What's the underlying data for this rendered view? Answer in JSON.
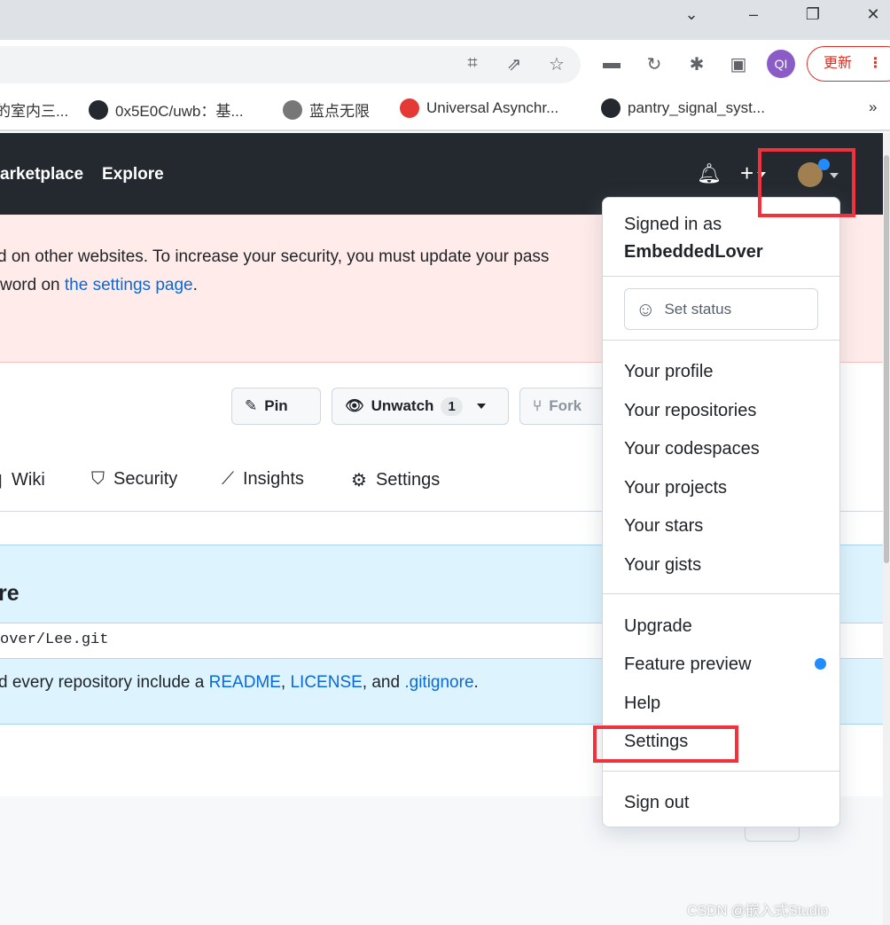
{
  "browser": {
    "bookmarks": [
      "的室内三...",
      "0x5E0C/uwb：基...",
      "蓝点无限",
      "Universal Asynchr...",
      "pantry_signal_syst..."
    ],
    "more": "»",
    "profile": "QI",
    "update_label": "更新"
  },
  "header": {
    "nav": [
      "arketplace",
      "Explore"
    ]
  },
  "banner": {
    "line1": "d on other websites. To increase your security, you must update your pass",
    "line2_pre": "word on ",
    "line2_link": "the settings page",
    "line2_post": "."
  },
  "repo_actions": {
    "pin": "Pin",
    "unwatch": "Unwatch",
    "watch_count": "1",
    "fork": "Fork"
  },
  "tabs": [
    "Wiki",
    "Security",
    "Insights",
    "Settings"
  ],
  "quick_setup": {
    "heading": "re",
    "url": "over/Lee.git",
    "tip_pre": "d every repository include a ",
    "readme": "README",
    "comma": ", ",
    "license": "LICENSE",
    "and": ", and ",
    "gitignore": ".gitignore",
    "end": "."
  },
  "menu": {
    "signed_in_as": "Signed in as",
    "username": "EmbeddedLover",
    "set_status": "Set status",
    "items1": [
      "Your profile",
      "Your repositories",
      "Your codespaces",
      "Your projects",
      "Your stars",
      "Your gists"
    ],
    "items2": [
      "Upgrade",
      "Feature preview",
      "Help",
      "Settings"
    ],
    "sign_out": "Sign out"
  },
  "watermark": "CSDN @嵌入式Studio",
  "colors": {
    "header": "#24292f",
    "highlight": "#f0323c",
    "link": "#0969da",
    "feature_dot": "#218bff"
  }
}
